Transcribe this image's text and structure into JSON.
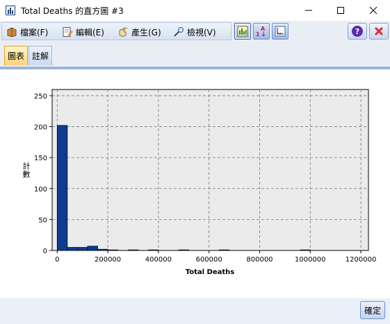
{
  "window": {
    "title": "Total Deaths 的直方圖 #3"
  },
  "menu": {
    "items": [
      {
        "label": "檔案(F)",
        "icon": "file-icon"
      },
      {
        "label": "編輯(E)",
        "icon": "edit-icon"
      },
      {
        "label": "產生(G)",
        "icon": "generate-icon"
      },
      {
        "label": "檢視(V)",
        "icon": "view-icon"
      }
    ]
  },
  "toolbar": {
    "buttons": [
      "copy-chart-icon",
      "sort-labels-icon",
      "chart-axis-icon"
    ],
    "help_icon": "help-icon",
    "close_icon": "close-icon"
  },
  "tabs": [
    {
      "label": "圖表",
      "active": true
    },
    {
      "label": "註解",
      "active": false
    }
  ],
  "footer": {
    "ok_label": "確定"
  },
  "colors": {
    "bar": "#0c3d8f",
    "plot_bg": "#ebebeb",
    "active_tab": "#ffd27a",
    "close_red": "#e4262c"
  },
  "chart_data": {
    "type": "bar",
    "subtype": "histogram",
    "xlabel": "Total Deaths",
    "ylabel": "計數",
    "xlim": [
      -20000,
      1230000
    ],
    "ylim": [
      0,
      260
    ],
    "xticks": [
      0,
      200000,
      400000,
      600000,
      800000,
      1000000,
      1200000
    ],
    "xtick_labels": [
      "0",
      "200000",
      "400000",
      "600000",
      "800000",
      "1000000",
      "1200000"
    ],
    "yticks": [
      0,
      50,
      100,
      150,
      200,
      250
    ],
    "ytick_labels": [
      "0",
      "50",
      "100",
      "150",
      "200",
      "250"
    ],
    "grid": true,
    "bin_width": 40000,
    "bins": [
      {
        "x0": 0,
        "x1": 40000,
        "count": 202
      },
      {
        "x0": 40000,
        "x1": 80000,
        "count": 5
      },
      {
        "x0": 80000,
        "x1": 120000,
        "count": 5
      },
      {
        "x0": 120000,
        "x1": 160000,
        "count": 7
      },
      {
        "x0": 160000,
        "x1": 200000,
        "count": 2
      },
      {
        "x0": 200000,
        "x1": 240000,
        "count": 1
      },
      {
        "x0": 280000,
        "x1": 320000,
        "count": 1
      },
      {
        "x0": 360000,
        "x1": 400000,
        "count": 1
      },
      {
        "x0": 480000,
        "x1": 520000,
        "count": 1
      },
      {
        "x0": 640000,
        "x1": 680000,
        "count": 1
      },
      {
        "x0": 960000,
        "x1": 1000000,
        "count": 1
      }
    ]
  }
}
